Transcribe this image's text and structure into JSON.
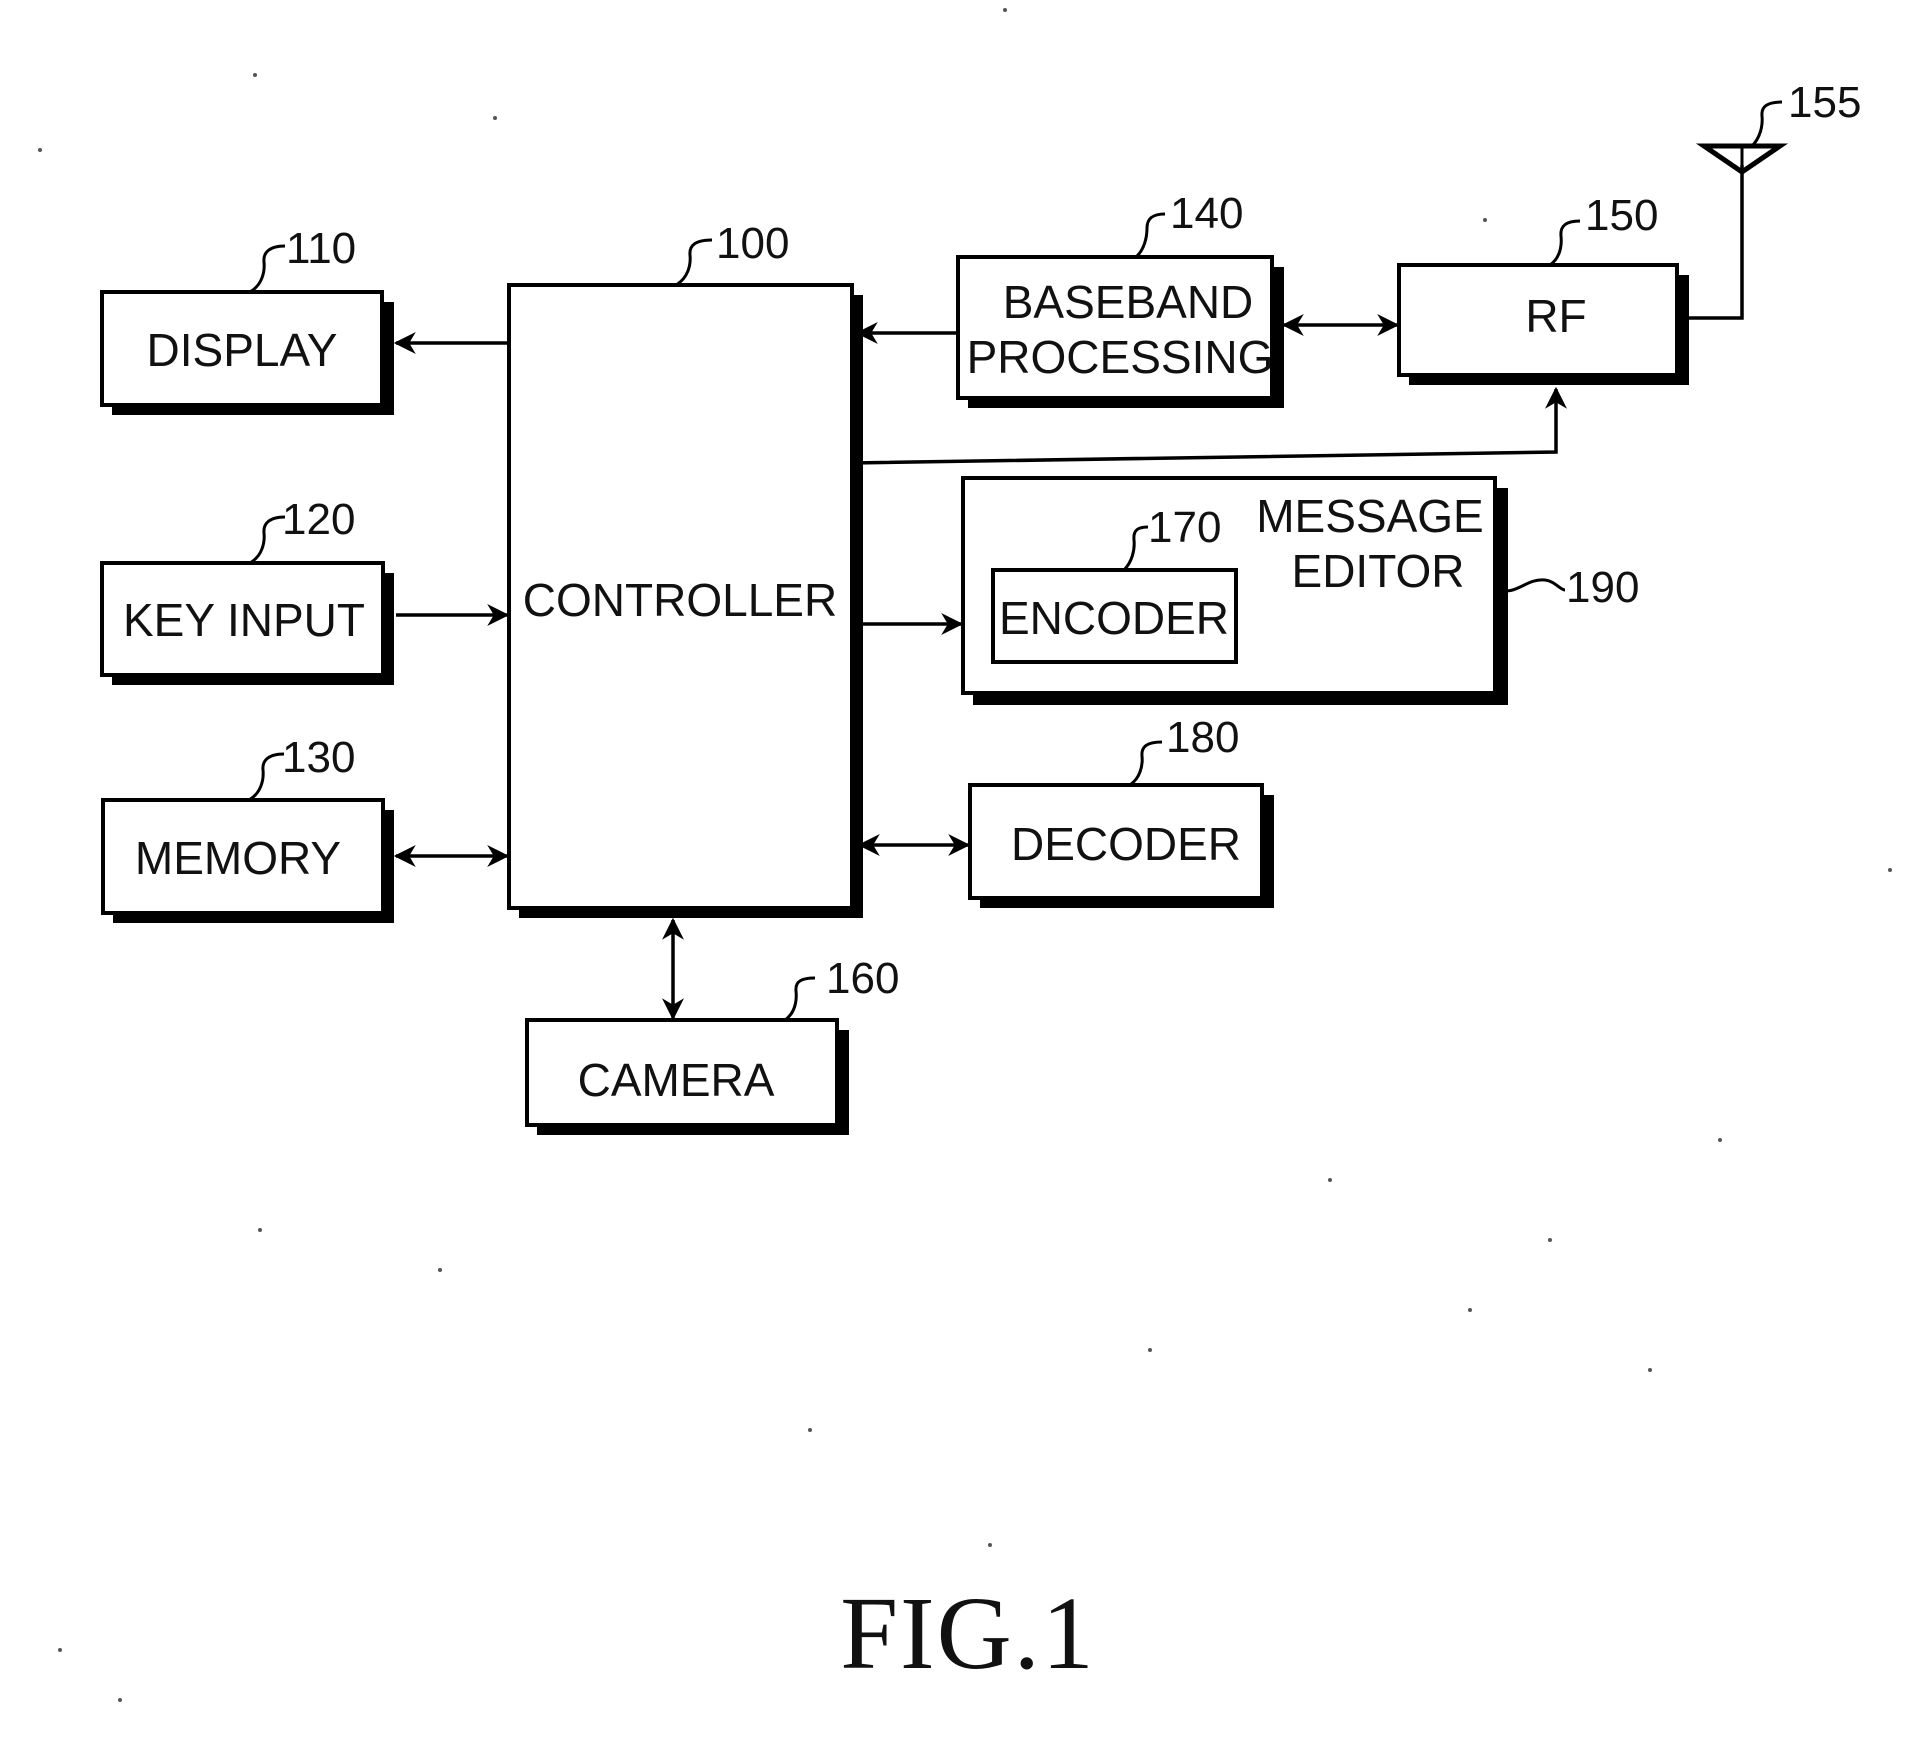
{
  "figure": {
    "caption": "FIG.1",
    "blocks": {
      "controller": {
        "label": "CONTROLLER",
        "ref": "100"
      },
      "display": {
        "label": "DISPLAY",
        "ref": "110"
      },
      "key_input": {
        "label": "KEY INPUT",
        "ref": "120"
      },
      "memory": {
        "label": "MEMORY",
        "ref": "130"
      },
      "baseband": {
        "label_line1": "BASEBAND",
        "label_line2": "PROCESSING",
        "ref": "140"
      },
      "rf": {
        "label": "RF",
        "ref": "150"
      },
      "antenna": {
        "ref": "155"
      },
      "camera": {
        "label": "CAMERA",
        "ref": "160"
      },
      "encoder": {
        "label": "ENCODER",
        "ref": "170"
      },
      "decoder": {
        "label": "DECODER",
        "ref": "180"
      },
      "message_editor": {
        "label_line1": "MESSAGE",
        "label_line2": "EDITOR",
        "ref": "190"
      }
    },
    "connections": [
      {
        "from": "controller",
        "to": "display",
        "direction": "one-way"
      },
      {
        "from": "key_input",
        "to": "controller",
        "direction": "one-way"
      },
      {
        "from": "controller",
        "to": "memory",
        "direction": "bidirectional"
      },
      {
        "from": "baseband",
        "to": "controller",
        "direction": "one-way"
      },
      {
        "from": "baseband",
        "to": "rf",
        "direction": "bidirectional"
      },
      {
        "from": "controller",
        "to": "rf",
        "direction": "one-way"
      },
      {
        "from": "rf",
        "to": "antenna",
        "direction": "line"
      },
      {
        "from": "controller",
        "to": "message_editor",
        "direction": "one-way"
      },
      {
        "from": "controller",
        "to": "decoder",
        "direction": "bidirectional"
      },
      {
        "from": "controller",
        "to": "camera",
        "direction": "bidirectional"
      }
    ]
  }
}
